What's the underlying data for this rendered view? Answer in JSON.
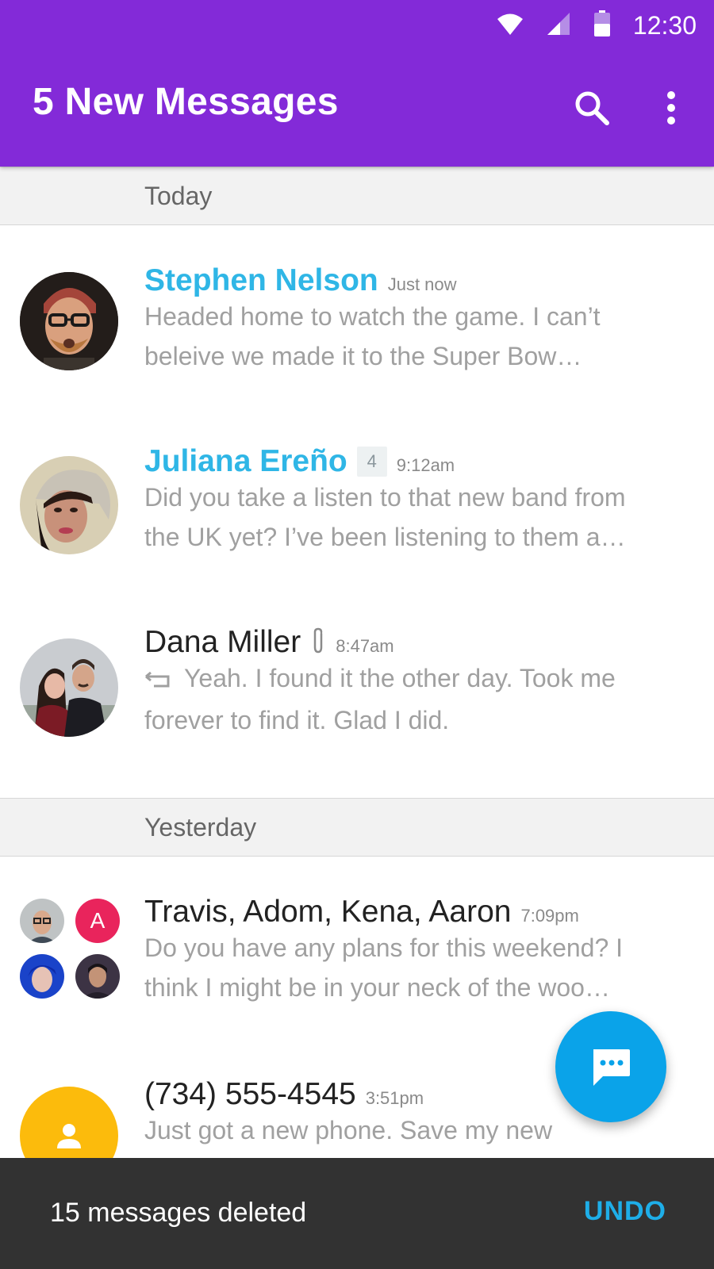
{
  "status_bar": {
    "time": "12:30",
    "icons": [
      "wifi-icon",
      "cell-signal-icon",
      "battery-icon"
    ]
  },
  "app_bar": {
    "title": "5 New Messages",
    "actions": [
      "search-icon",
      "overflow-menu-icon"
    ],
    "color": "#832ad8"
  },
  "sections": {
    "today": "Today",
    "yesterday": "Yesterday"
  },
  "messages": [
    {
      "name": "Stephen Nelson",
      "time": "Just now",
      "unread": true,
      "lines": [
        "Headed home to watch the game. I can’t",
        "beleive we made it to the Super Bow…"
      ]
    },
    {
      "name": "Juliana Ereño",
      "count": "4",
      "time": "9:12am",
      "unread": true,
      "lines": [
        "Did you take a listen to that new band from",
        "the UK yet? I’ve been listening to them a…"
      ]
    },
    {
      "name": "Dana Miller",
      "time": "8:47am",
      "has_attachment": true,
      "replied": true,
      "lines": [
        "Yeah. I found it the other day. Took me",
        "forever to find it. Glad I did."
      ]
    },
    {
      "name": "Travis, Adom, Kena, Aaron",
      "time": "7:09pm",
      "group_initial": "A",
      "lines": [
        "Do you have any plans for this weekend? I",
        "think I might be in your neck of the woo…"
      ]
    },
    {
      "name": "(734) 555-4545",
      "time": "3:51pm",
      "lines": [
        "Just got a new phone. Save my new"
      ]
    }
  ],
  "fab": {
    "icon": "new-message-icon",
    "color": "#0aa3e9"
  },
  "snackbar": {
    "message": "15 messages deleted",
    "action": "UNDO",
    "action_color": "#1eaee8"
  },
  "colors": {
    "unread_name": "#2fb6e6",
    "group_avatar_a": "#e9245c",
    "unknown_contact_avatar": "#fcbb0c"
  }
}
